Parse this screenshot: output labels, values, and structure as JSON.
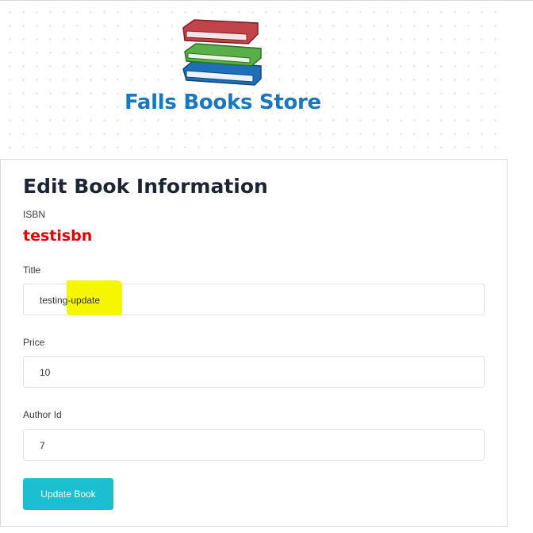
{
  "header": {
    "logo_text": "Falls Books Store",
    "logo_icon": "stack-of-books-icon"
  },
  "form": {
    "title": "Edit Book Information",
    "isbn_label": "ISBN",
    "isbn_value": "testisbn",
    "title_label": "Title",
    "title_value": "testing-update",
    "price_label": "Price",
    "price_value": "10",
    "author_label": "Author Id",
    "author_value": "7",
    "submit_label": "Update Book"
  },
  "colors": {
    "logo_text": "#1a77bf",
    "isbn_value": "#e00000",
    "button": "#1cbfcf",
    "highlight": "#f6f600"
  }
}
